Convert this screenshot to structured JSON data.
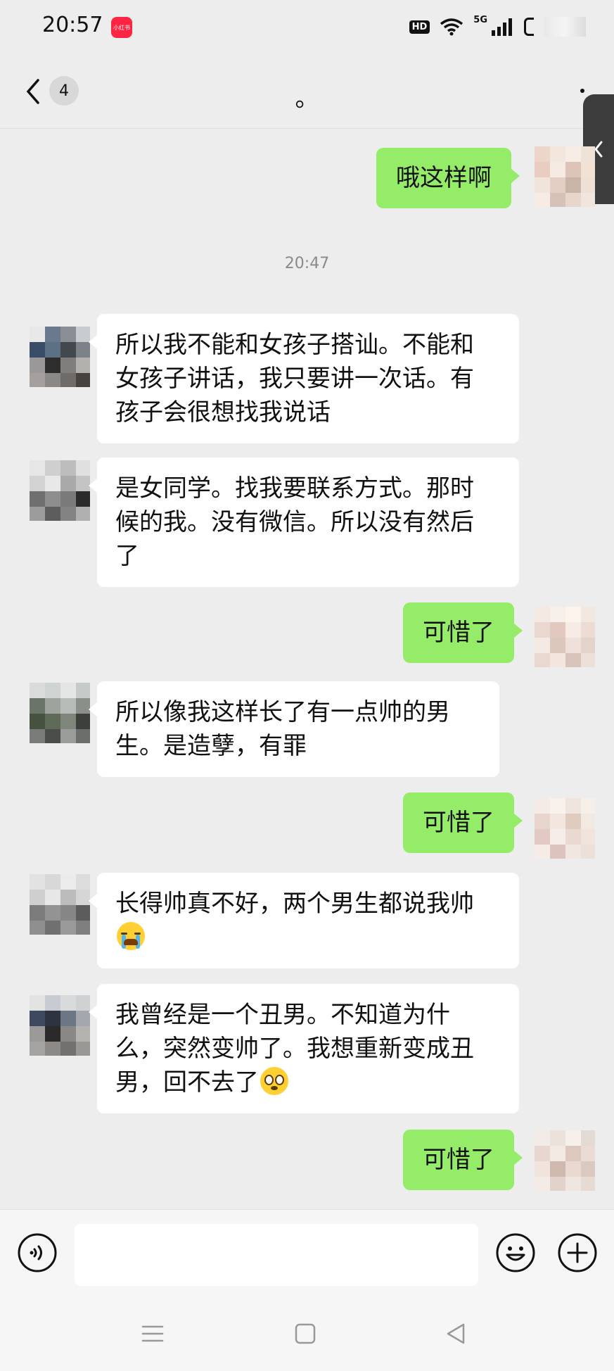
{
  "status_bar": {
    "time": "20:57",
    "app_badge": "小红书",
    "hd": "HD",
    "network": "5G"
  },
  "nav": {
    "unread_count": "4",
    "title": "。"
  },
  "chat": {
    "timestamp": "20:47",
    "messages": [
      {
        "side": "right",
        "text": "哦这样啊"
      },
      {
        "side": "left",
        "lines": [
          "所以我不能和女孩子搭讪。不能和",
          "女孩子讲话，我只要讲一次话。有",
          "孩子会很想找我说话"
        ]
      },
      {
        "side": "left",
        "lines": [
          "是女同学。找我要联系方式。那时",
          "候的我。没有微信。所以没有然后",
          "了"
        ]
      },
      {
        "side": "right",
        "text": "可惜了"
      },
      {
        "side": "left",
        "lines": [
          "所以像我这样长了有一点帅的男",
          "生。是造孽，有罪"
        ]
      },
      {
        "side": "right",
        "text": "可惜了"
      },
      {
        "side": "left",
        "lines": [
          "长得帅真不好，两个男生都说我帅"
        ],
        "emoji": "loudly-crying-face"
      },
      {
        "side": "left",
        "lines": [
          "我曾经是一个丑男。不知道为什",
          "么，突然变帅了。我想重新变成丑",
          "男，回不去了"
        ],
        "emoji": "flushed-face"
      },
      {
        "side": "right",
        "text": "可惜了"
      }
    ]
  },
  "input": {
    "value": "",
    "placeholder": ""
  },
  "colors": {
    "background": "#ededed",
    "bubble_self": "#95ec69",
    "bubble_other": "#ffffff",
    "timestamp": "#8a8a8a"
  }
}
